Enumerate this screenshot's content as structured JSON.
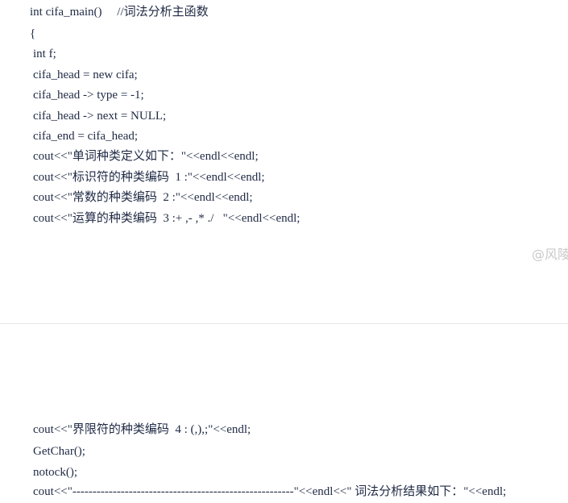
{
  "code_top": [
    "int cifa_main()     //词法分析主函数",
    "{",
    "int f;",
    "cifa_head = new cifa;",
    "cifa_head -> type = -1;",
    "cifa_head -> next = NULL;",
    "cifa_end = cifa_head;",
    "cout<<\"单词种类定义如下：\"<<endl<<endl;",
    "cout<<\"标识符的种类编码  1 :\"<<endl<<endl;",
    "cout<<\"常数的种类编码  2 :\"<<endl<<endl;",
    "cout<<\"运算的种类编码  3 :+ ,- ,* ./   \"<<endl<<endl;"
  ],
  "watermark": "@风陵",
  "code_bottom": [
    "cout<<\"界限符的种类编码  4 : (,),;\"<<endl;",
    "GetChar();",
    "notock();",
    "cout<<\"-------------------------------------------------------\"<<endl<<\" 词法分析结果如下：\"<<endl;"
  ]
}
